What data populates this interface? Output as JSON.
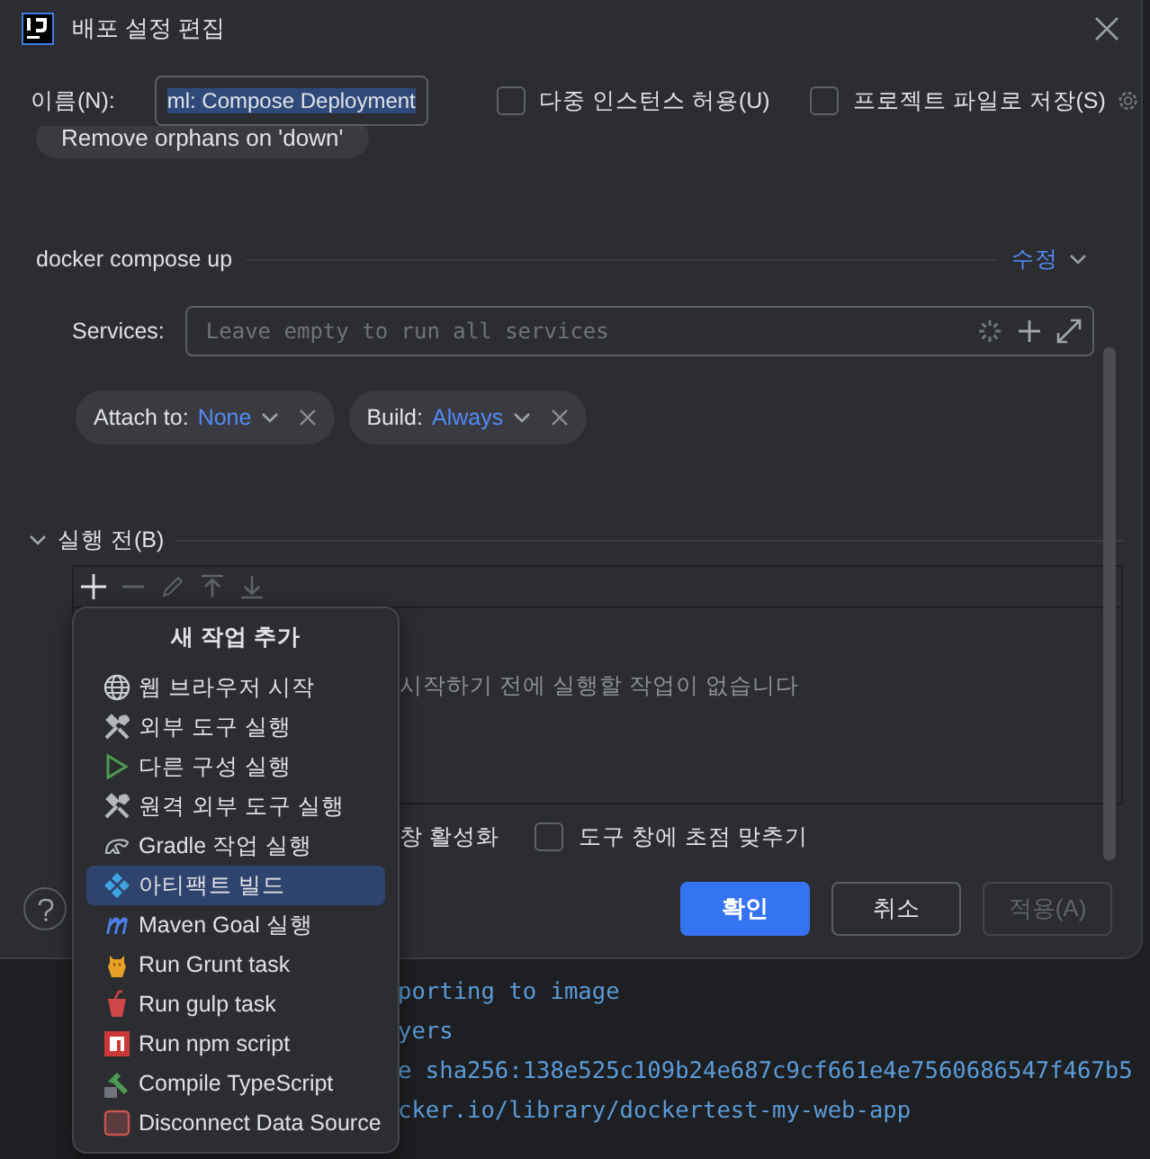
{
  "console": {
    "lines": [
      "porting to image",
      "yers",
      "e sha256:138e525c109b24e687c9cf661e4e7560686547f467b5",
      "cker.io/library/dockertest-my-web-app"
    ]
  },
  "dialog": {
    "title": "배포 설정 편집",
    "name_label": "이름(N):",
    "name_value": "ml: Compose Deployment",
    "options": [
      {
        "label": "다중 인스턴스 허용(U)",
        "checked": false
      },
      {
        "label": "프로젝트 파일로 저장(S)",
        "checked": false
      }
    ],
    "hidden_chip": "Remove orphans on 'down'",
    "section": {
      "title": "docker compose up",
      "modify_link": "수정"
    },
    "services": {
      "label": "Services:",
      "placeholder": "Leave empty to run all services"
    },
    "chips": [
      {
        "label": "Attach to:",
        "value": "None"
      },
      {
        "label": "Build:",
        "value": "Always"
      }
    ],
    "before_launch": {
      "title": "실행 전(B)",
      "expanded": true,
      "empty_text": "시작하기 전에 실행할 작업이 없습니다"
    },
    "launch_options": [
      {
        "label": "창 활성화"
      },
      {
        "label": "도구 창에 초점 맞추기",
        "checked": false
      }
    ],
    "buttons": [
      {
        "label": "확인",
        "kind": "primary"
      },
      {
        "label": "취소",
        "kind": "default"
      },
      {
        "label": "적용(A)",
        "kind": "disabled"
      }
    ]
  },
  "popup": {
    "title": "새 작업 추가",
    "items": [
      {
        "label": "웹 브라우저 시작",
        "kind": "globe",
        "selected": false
      },
      {
        "label": "외부 도구 실행",
        "kind": "tools",
        "selected": false
      },
      {
        "label": "다른 구성 실행",
        "kind": "play",
        "selected": false
      },
      {
        "label": "원격 외부 도구 실행",
        "kind": "tools",
        "selected": false
      },
      {
        "label": "Gradle 작업 실행",
        "kind": "gradle",
        "selected": false
      },
      {
        "label": "아티팩트 빌드",
        "kind": "artifact",
        "selected": true
      },
      {
        "label": "Maven Goal 실행",
        "kind": "maven",
        "selected": false
      },
      {
        "label": "Run Grunt task",
        "kind": "grunt",
        "selected": false
      },
      {
        "label": "Run gulp task",
        "kind": "gulp",
        "selected": false
      },
      {
        "label": "Run npm script",
        "kind": "npm",
        "selected": false
      },
      {
        "label": "Compile TypeScript",
        "kind": "typescript",
        "selected": false
      },
      {
        "label": "Disconnect Data Source",
        "kind": "datasource",
        "selected": false
      }
    ]
  }
}
